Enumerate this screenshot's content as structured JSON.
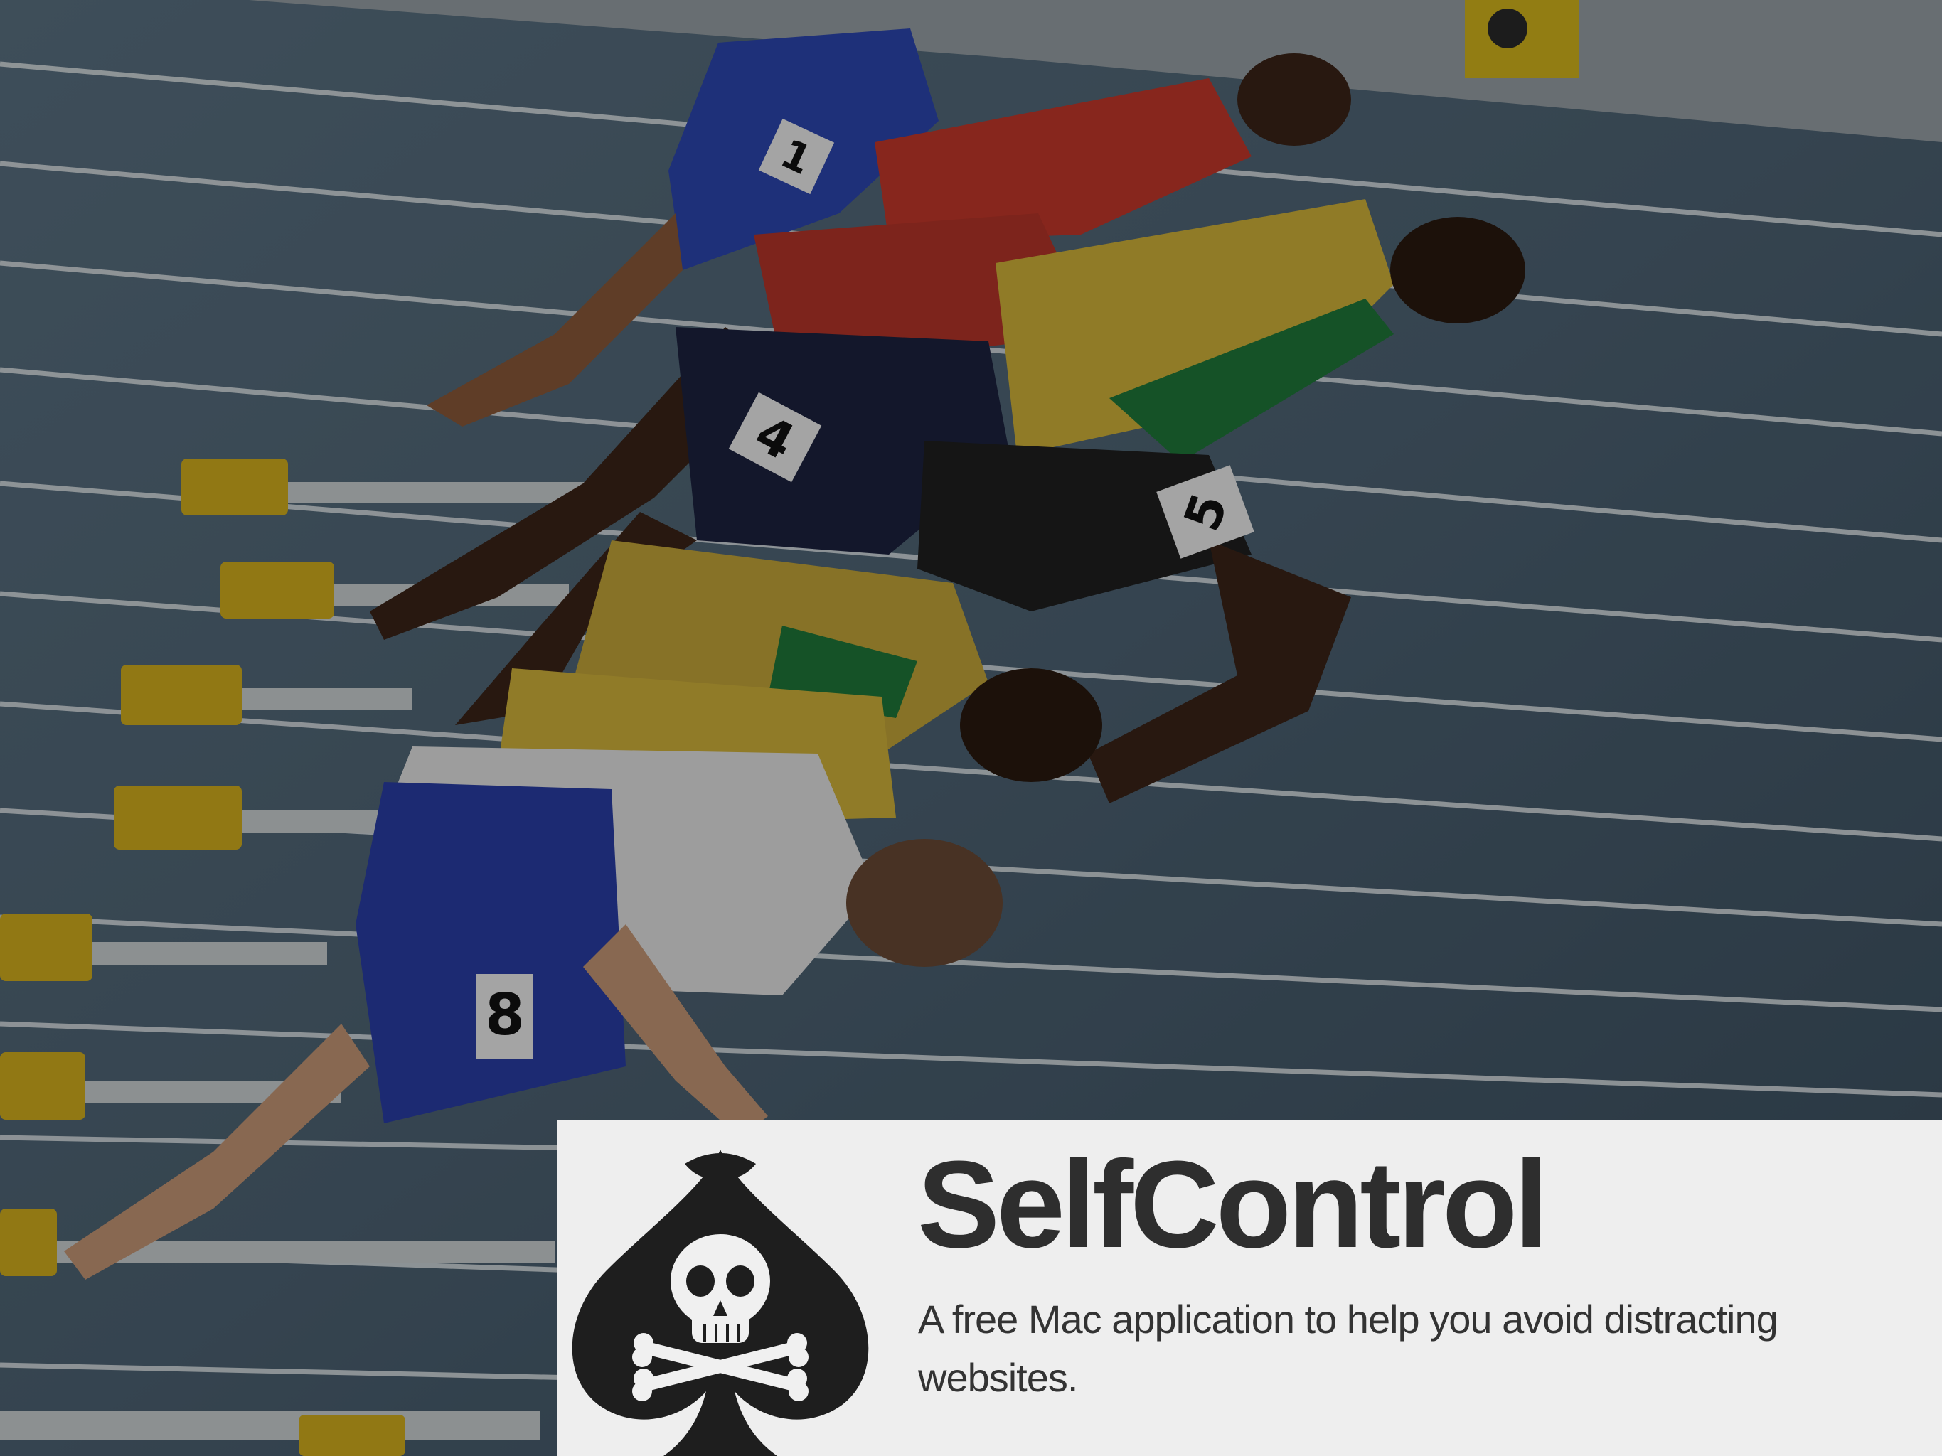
{
  "hero": {
    "image": "sprinters-at-starting-blocks",
    "bib_numbers": [
      "1",
      "4",
      "5",
      "8"
    ]
  },
  "app": {
    "logo_icon": "skull-crossbones-spade-icon",
    "title": "SelfControl",
    "tagline": "A free Mac application to help you avoid distracting websites."
  },
  "colors": {
    "track": "#4d6272",
    "card_background": "#eeeeee",
    "title_text": "#2e2e2e"
  }
}
